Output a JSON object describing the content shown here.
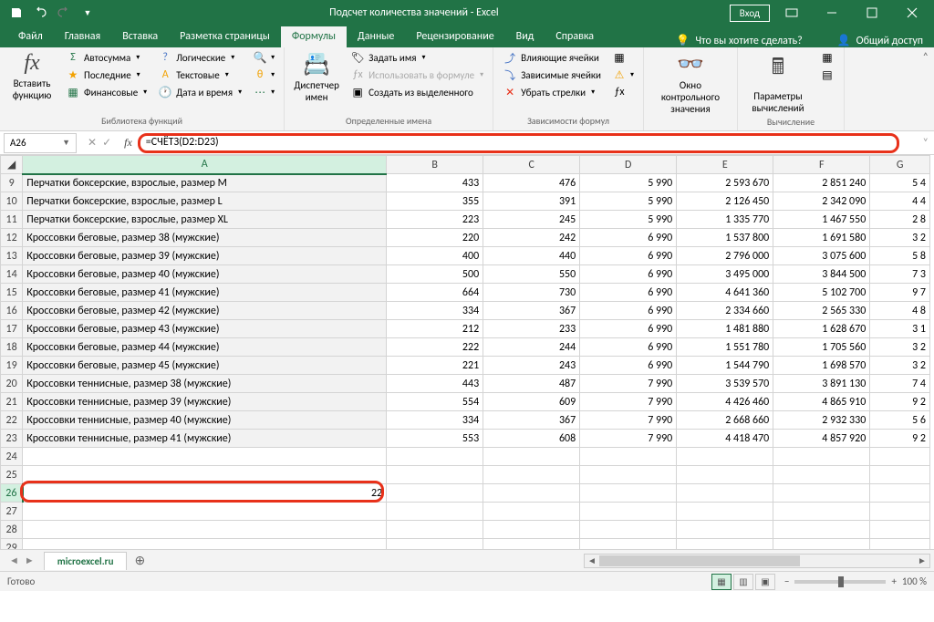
{
  "title": "Подсчет количества значений  -  Excel",
  "login": "Вход",
  "menu": {
    "file": "Файл",
    "home": "Главная",
    "insert": "Вставка",
    "layout": "Разметка страницы",
    "formulas": "Формулы",
    "data": "Данные",
    "review": "Рецензирование",
    "view": "Вид",
    "help": "Справка",
    "tellme": "Что вы хотите сделать?",
    "share": "Общий доступ"
  },
  "ribbon": {
    "insert_fn": "Вставить\nфункцию",
    "lib": {
      "autosum": "Автосумма",
      "recent": "Последние",
      "financial": "Финансовые",
      "logical": "Логические",
      "text": "Текстовые",
      "datetime": "Дата и время",
      "lookup": "",
      "math": "",
      "more": "",
      "label": "Библиотека функций"
    },
    "names": {
      "mgr": "Диспетчер\nимен",
      "define": "Задать имя",
      "use": "Использовать в формуле",
      "create": "Создать из выделенного",
      "label": "Определенные имена"
    },
    "audit": {
      "precedents": "Влияющие ячейки",
      "dependents": "Зависимые ячейки",
      "remove": "Убрать стрелки",
      "label": "Зависимости формул"
    },
    "watch": "Окно контрольного\nзначения",
    "calc": {
      "options": "Параметры\nвычислений",
      "label": "Вычисление"
    }
  },
  "namebox": "A26",
  "formula": "=СЧЁТЗ(D2:D23)",
  "columns": [
    "A",
    "B",
    "C",
    "D",
    "E",
    "F",
    "G"
  ],
  "rows": [
    {
      "n": 9,
      "a": "Перчатки боксерские, взрослые, размер M",
      "b": "433",
      "c": "476",
      "d": "5 990",
      "e": "2 593 670",
      "f": "2 851 240",
      "g": "5 4"
    },
    {
      "n": 10,
      "a": "Перчатки боксерские, взрослые, размер L",
      "b": "355",
      "c": "391",
      "d": "5 990",
      "e": "2 126 450",
      "f": "2 342 090",
      "g": "4 4"
    },
    {
      "n": 11,
      "a": "Перчатки боксерские, взрослые, размер XL",
      "b": "223",
      "c": "245",
      "d": "5 990",
      "e": "1 335 770",
      "f": "1 467 550",
      "g": "2 8"
    },
    {
      "n": 12,
      "a": "Кроссовки беговые, размер 38 (мужские)",
      "b": "220",
      "c": "242",
      "d": "6 990",
      "e": "1 537 800",
      "f": "1 691 580",
      "g": "3 2"
    },
    {
      "n": 13,
      "a": "Кроссовки беговые, размер 39 (мужские)",
      "b": "400",
      "c": "440",
      "d": "6 990",
      "e": "2 796 000",
      "f": "3 075 600",
      "g": "5 8"
    },
    {
      "n": 14,
      "a": "Кроссовки беговые, размер 40 (мужские)",
      "b": "500",
      "c": "550",
      "d": "6 990",
      "e": "3 495 000",
      "f": "3 844 500",
      "g": "7 3"
    },
    {
      "n": 15,
      "a": "Кроссовки беговые, размер 41 (мужские)",
      "b": "664",
      "c": "730",
      "d": "6 990",
      "e": "4 641 360",
      "f": "5 102 700",
      "g": "9 7"
    },
    {
      "n": 16,
      "a": "Кроссовки беговые, размер 42 (мужские)",
      "b": "334",
      "c": "367",
      "d": "6 990",
      "e": "2 334 660",
      "f": "2 565 330",
      "g": "4 8"
    },
    {
      "n": 17,
      "a": "Кроссовки беговые, размер 43 (мужские)",
      "b": "212",
      "c": "233",
      "d": "6 990",
      "e": "1 481 880",
      "f": "1 628 670",
      "g": "3 1"
    },
    {
      "n": 18,
      "a": "Кроссовки беговые, размер 44 (мужские)",
      "b": "222",
      "c": "244",
      "d": "6 990",
      "e": "1 551 780",
      "f": "1 705 560",
      "g": "3 2"
    },
    {
      "n": 19,
      "a": "Кроссовки беговые, размер 45 (мужские)",
      "b": "221",
      "c": "243",
      "d": "6 990",
      "e": "1 544 790",
      "f": "1 698 570",
      "g": "3 2"
    },
    {
      "n": 20,
      "a": "Кроссовки теннисные, размер 38 (мужские)",
      "b": "443",
      "c": "487",
      "d": "7 990",
      "e": "3 539 570",
      "f": "3 891 130",
      "g": "7 4"
    },
    {
      "n": 21,
      "a": "Кроссовки теннисные, размер 39 (мужские)",
      "b": "554",
      "c": "609",
      "d": "7 990",
      "e": "4 426 460",
      "f": "4 865 910",
      "g": "9 2"
    },
    {
      "n": 22,
      "a": "Кроссовки теннисные, размер 40 (мужские)",
      "b": "334",
      "c": "367",
      "d": "7 990",
      "e": "2 668 660",
      "f": "2 932 330",
      "g": "5 6"
    },
    {
      "n": 23,
      "a": "Кроссовки теннисные, размер 41 (мужские)",
      "b": "553",
      "c": "608",
      "d": "7 990",
      "e": "4 418 470",
      "f": "4 857 920",
      "g": "9 2"
    }
  ],
  "empty_rows": [
    24,
    25
  ],
  "result_row": {
    "n": 26,
    "value": "22"
  },
  "trailing_rows": [
    27,
    28,
    29
  ],
  "sheet": "microexcel.ru",
  "status": "Готово",
  "zoom": "100 %"
}
